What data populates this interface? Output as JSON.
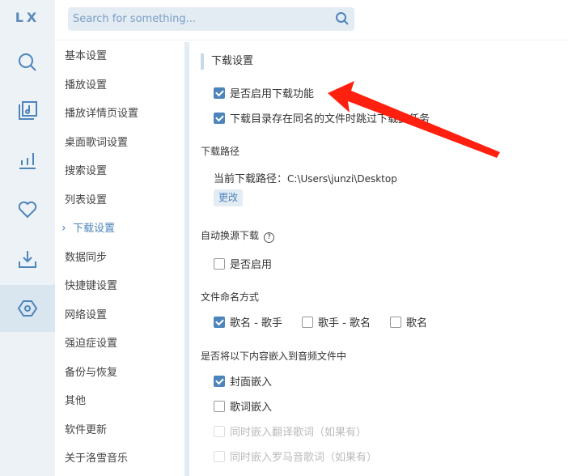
{
  "app": {
    "logo": "LX"
  },
  "rail": {
    "items": [
      {
        "icon": "search-icon"
      },
      {
        "icon": "music-library-icon"
      },
      {
        "icon": "chart-icon"
      },
      {
        "icon": "heart-icon"
      },
      {
        "icon": "download-icon"
      },
      {
        "icon": "settings-icon",
        "active": true
      }
    ]
  },
  "search": {
    "placeholder": "Search for something..."
  },
  "nav": {
    "items": [
      "基本设置",
      "播放设置",
      "播放详情页设置",
      "桌面歌词设置",
      "搜索设置",
      "列表设置",
      "下载设置",
      "数据同步",
      "快捷键设置",
      "网络设置",
      "强迫症设置",
      "备份与恢复",
      "其他",
      "软件更新",
      "关于洛雪音乐"
    ],
    "active": "下载设置"
  },
  "section": {
    "title": "下载设置",
    "enable_download": {
      "label": "是否启用下载功能",
      "checked": true
    },
    "skip_existing": {
      "label": "下载目录存在同名的文件时跳过下载此任务",
      "checked": true
    },
    "path_heading": "下载路径",
    "current_path_label": "当前下载路径：",
    "current_path": "C:\\Users\\junzi\\Desktop",
    "change_button": "更改",
    "auto_source_heading": "自动换源下载",
    "auto_source_enable": {
      "label": "是否启用",
      "checked": false
    },
    "naming_heading": "文件命名方式",
    "naming_options": [
      {
        "label": "歌名 - 歌手",
        "checked": true
      },
      {
        "label": "歌手 - 歌名",
        "checked": false
      },
      {
        "label": "歌名",
        "checked": false
      }
    ],
    "embed_heading": "是否将以下内容嵌入到音频文件中",
    "embed_options": [
      {
        "label": "封面嵌入",
        "checked": true
      },
      {
        "label": "歌词嵌入",
        "checked": false
      },
      {
        "label": "同时嵌入翻译歌词（如果有）",
        "checked": false,
        "disabled": true
      },
      {
        "label": "同时嵌入罗马音歌词（如果有）",
        "checked": false,
        "disabled": true
      }
    ]
  },
  "annotation": {
    "arrow_color": "#ff2010"
  }
}
